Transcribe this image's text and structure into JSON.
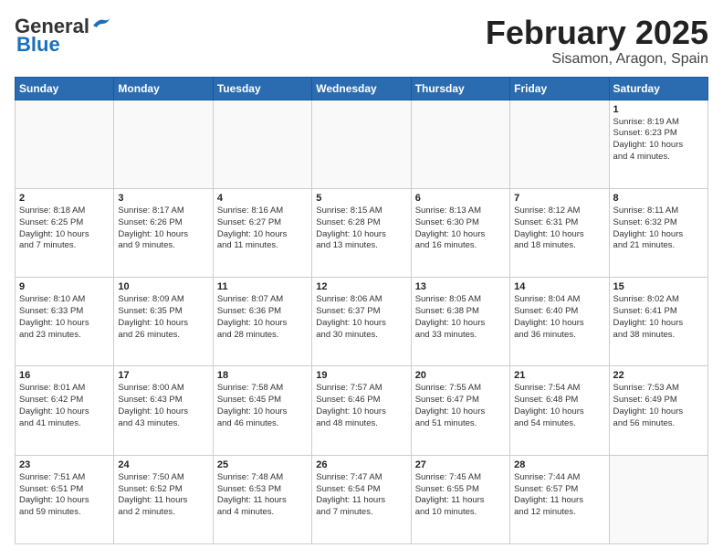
{
  "logo": {
    "general": "General",
    "blue": "Blue"
  },
  "header": {
    "month": "February 2025",
    "location": "Sisamon, Aragon, Spain"
  },
  "weekdays": [
    "Sunday",
    "Monday",
    "Tuesday",
    "Wednesday",
    "Thursday",
    "Friday",
    "Saturday"
  ],
  "weeks": [
    [
      {
        "day": "",
        "info": ""
      },
      {
        "day": "",
        "info": ""
      },
      {
        "day": "",
        "info": ""
      },
      {
        "day": "",
        "info": ""
      },
      {
        "day": "",
        "info": ""
      },
      {
        "day": "",
        "info": ""
      },
      {
        "day": "1",
        "info": "Sunrise: 8:19 AM\nSunset: 6:23 PM\nDaylight: 10 hours\nand 4 minutes."
      }
    ],
    [
      {
        "day": "2",
        "info": "Sunrise: 8:18 AM\nSunset: 6:25 PM\nDaylight: 10 hours\nand 7 minutes."
      },
      {
        "day": "3",
        "info": "Sunrise: 8:17 AM\nSunset: 6:26 PM\nDaylight: 10 hours\nand 9 minutes."
      },
      {
        "day": "4",
        "info": "Sunrise: 8:16 AM\nSunset: 6:27 PM\nDaylight: 10 hours\nand 11 minutes."
      },
      {
        "day": "5",
        "info": "Sunrise: 8:15 AM\nSunset: 6:28 PM\nDaylight: 10 hours\nand 13 minutes."
      },
      {
        "day": "6",
        "info": "Sunrise: 8:13 AM\nSunset: 6:30 PM\nDaylight: 10 hours\nand 16 minutes."
      },
      {
        "day": "7",
        "info": "Sunrise: 8:12 AM\nSunset: 6:31 PM\nDaylight: 10 hours\nand 18 minutes."
      },
      {
        "day": "8",
        "info": "Sunrise: 8:11 AM\nSunset: 6:32 PM\nDaylight: 10 hours\nand 21 minutes."
      }
    ],
    [
      {
        "day": "9",
        "info": "Sunrise: 8:10 AM\nSunset: 6:33 PM\nDaylight: 10 hours\nand 23 minutes."
      },
      {
        "day": "10",
        "info": "Sunrise: 8:09 AM\nSunset: 6:35 PM\nDaylight: 10 hours\nand 26 minutes."
      },
      {
        "day": "11",
        "info": "Sunrise: 8:07 AM\nSunset: 6:36 PM\nDaylight: 10 hours\nand 28 minutes."
      },
      {
        "day": "12",
        "info": "Sunrise: 8:06 AM\nSunset: 6:37 PM\nDaylight: 10 hours\nand 30 minutes."
      },
      {
        "day": "13",
        "info": "Sunrise: 8:05 AM\nSunset: 6:38 PM\nDaylight: 10 hours\nand 33 minutes."
      },
      {
        "day": "14",
        "info": "Sunrise: 8:04 AM\nSunset: 6:40 PM\nDaylight: 10 hours\nand 36 minutes."
      },
      {
        "day": "15",
        "info": "Sunrise: 8:02 AM\nSunset: 6:41 PM\nDaylight: 10 hours\nand 38 minutes."
      }
    ],
    [
      {
        "day": "16",
        "info": "Sunrise: 8:01 AM\nSunset: 6:42 PM\nDaylight: 10 hours\nand 41 minutes."
      },
      {
        "day": "17",
        "info": "Sunrise: 8:00 AM\nSunset: 6:43 PM\nDaylight: 10 hours\nand 43 minutes."
      },
      {
        "day": "18",
        "info": "Sunrise: 7:58 AM\nSunset: 6:45 PM\nDaylight: 10 hours\nand 46 minutes."
      },
      {
        "day": "19",
        "info": "Sunrise: 7:57 AM\nSunset: 6:46 PM\nDaylight: 10 hours\nand 48 minutes."
      },
      {
        "day": "20",
        "info": "Sunrise: 7:55 AM\nSunset: 6:47 PM\nDaylight: 10 hours\nand 51 minutes."
      },
      {
        "day": "21",
        "info": "Sunrise: 7:54 AM\nSunset: 6:48 PM\nDaylight: 10 hours\nand 54 minutes."
      },
      {
        "day": "22",
        "info": "Sunrise: 7:53 AM\nSunset: 6:49 PM\nDaylight: 10 hours\nand 56 minutes."
      }
    ],
    [
      {
        "day": "23",
        "info": "Sunrise: 7:51 AM\nSunset: 6:51 PM\nDaylight: 10 hours\nand 59 minutes."
      },
      {
        "day": "24",
        "info": "Sunrise: 7:50 AM\nSunset: 6:52 PM\nDaylight: 11 hours\nand 2 minutes."
      },
      {
        "day": "25",
        "info": "Sunrise: 7:48 AM\nSunset: 6:53 PM\nDaylight: 11 hours\nand 4 minutes."
      },
      {
        "day": "26",
        "info": "Sunrise: 7:47 AM\nSunset: 6:54 PM\nDaylight: 11 hours\nand 7 minutes."
      },
      {
        "day": "27",
        "info": "Sunrise: 7:45 AM\nSunset: 6:55 PM\nDaylight: 11 hours\nand 10 minutes."
      },
      {
        "day": "28",
        "info": "Sunrise: 7:44 AM\nSunset: 6:57 PM\nDaylight: 11 hours\nand 12 minutes."
      },
      {
        "day": "",
        "info": ""
      }
    ]
  ]
}
